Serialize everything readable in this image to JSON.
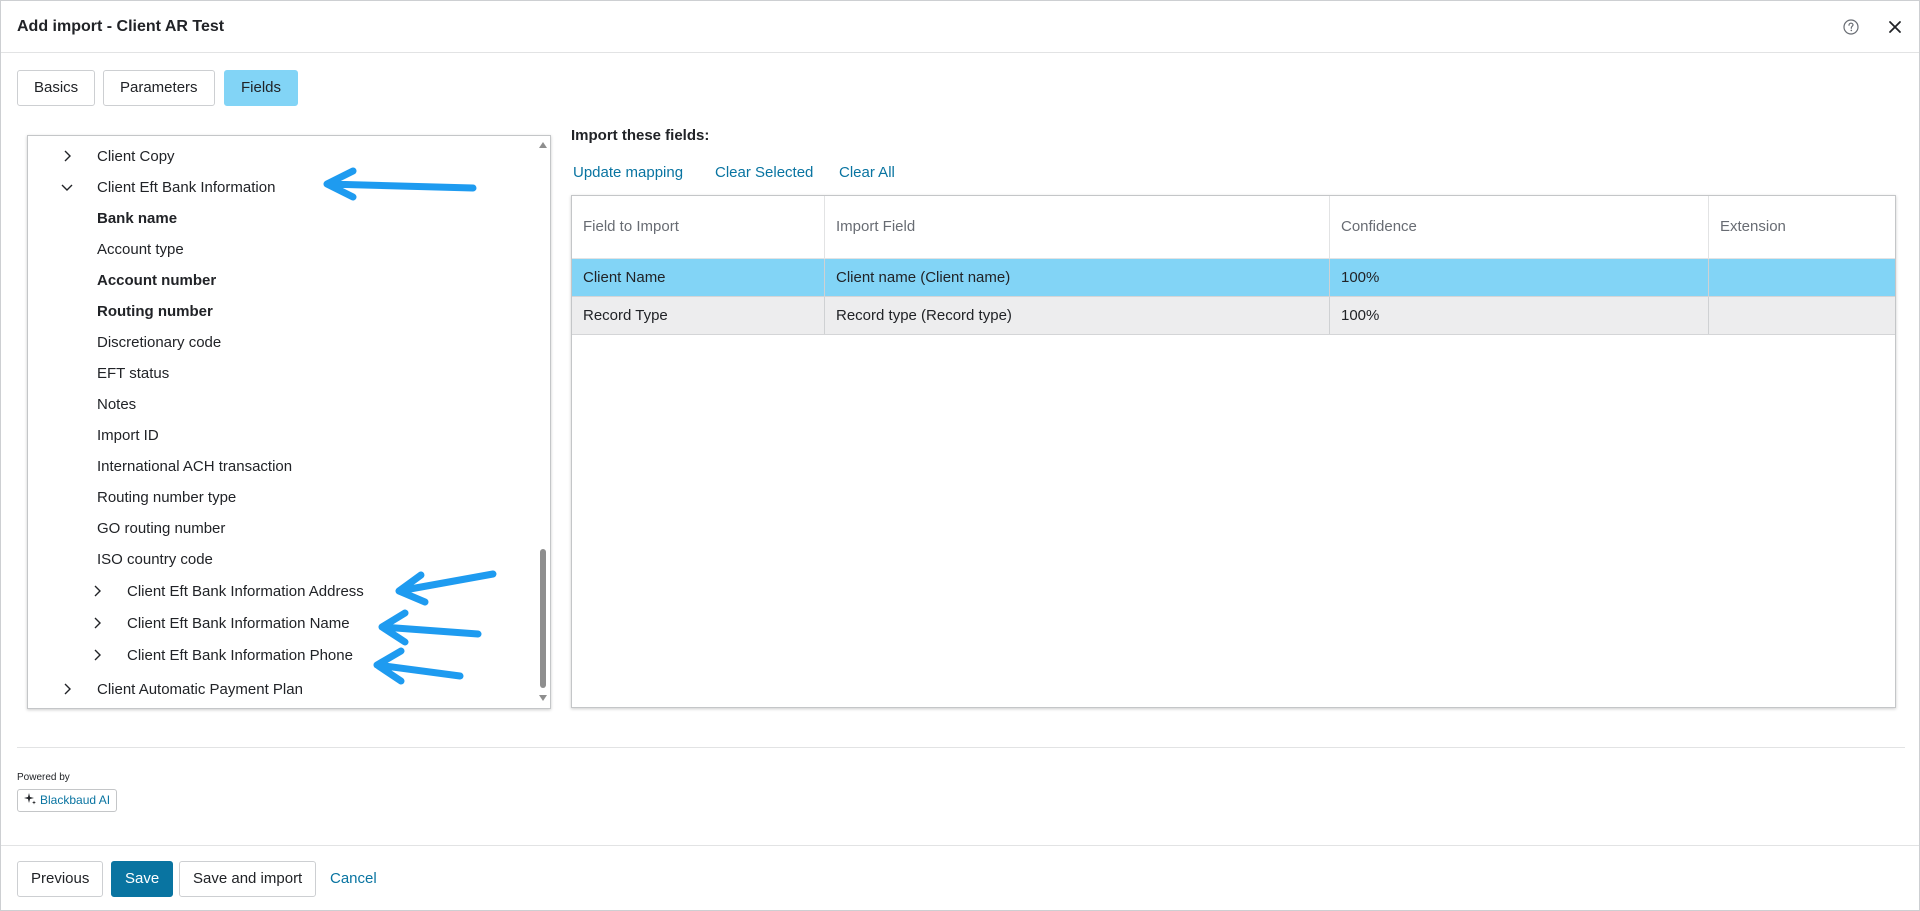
{
  "dialog": {
    "title": "Add import - Client AR Test",
    "help_icon": "question-circle-icon",
    "close_icon": "close-icon"
  },
  "tabs": [
    {
      "label": "Basics",
      "active": false
    },
    {
      "label": "Parameters",
      "active": false
    },
    {
      "label": "Fields",
      "active": true
    }
  ],
  "tree": {
    "items": [
      {
        "label": "Client Copy",
        "expander": "collapsed",
        "bold": false
      },
      {
        "label": "Client Eft Bank Information",
        "expander": "expanded",
        "bold": false
      },
      {
        "label": "Bank name",
        "bold": true
      },
      {
        "label": "Account type",
        "bold": false
      },
      {
        "label": "Account number",
        "bold": true
      },
      {
        "label": "Routing number",
        "bold": true
      },
      {
        "label": "Discretionary code",
        "bold": false
      },
      {
        "label": "EFT status",
        "bold": false
      },
      {
        "label": "Notes",
        "bold": false
      },
      {
        "label": "Import ID",
        "bold": false
      },
      {
        "label": "International ACH transaction",
        "bold": false
      },
      {
        "label": "Routing number type",
        "bold": false
      },
      {
        "label": "GO routing number",
        "bold": false
      },
      {
        "label": "ISO country code",
        "bold": false
      },
      {
        "label": "Client Eft Bank Information Address",
        "expander": "collapsed",
        "bold": false
      },
      {
        "label": "Client Eft Bank Information Name",
        "expander": "collapsed",
        "bold": false
      },
      {
        "label": "Client Eft Bank Information Phone",
        "expander": "collapsed",
        "bold": false
      },
      {
        "label": "Client Automatic Payment Plan",
        "expander": "collapsed",
        "bold": false
      }
    ]
  },
  "import_section": {
    "label": "Import these fields:",
    "actions": {
      "update_mapping": "Update mapping",
      "clear_selected": "Clear Selected",
      "clear_all": "Clear All"
    },
    "columns": [
      "Field to Import",
      "Import Field",
      "Confidence",
      "Extension"
    ],
    "rows": [
      {
        "field_to_import": "Client Name",
        "import_field": "Client name (Client name)",
        "confidence": "100%",
        "extension": "",
        "selected": true
      },
      {
        "field_to_import": "Record Type",
        "import_field": "Record type (Record type)",
        "confidence": "100%",
        "extension": "",
        "selected": false
      }
    ]
  },
  "powered_by": {
    "label": "Powered by",
    "badge": "Blackbaud AI",
    "badge_icon": "sparkle-icon"
  },
  "footer": {
    "previous": "Previous",
    "save": "Save",
    "save_and_import": "Save and import",
    "cancel": "Cancel"
  },
  "colors": {
    "accent": "#0974a1",
    "selected_row": "#82d4f6",
    "annotation_arrow": "#1e9bf0"
  }
}
